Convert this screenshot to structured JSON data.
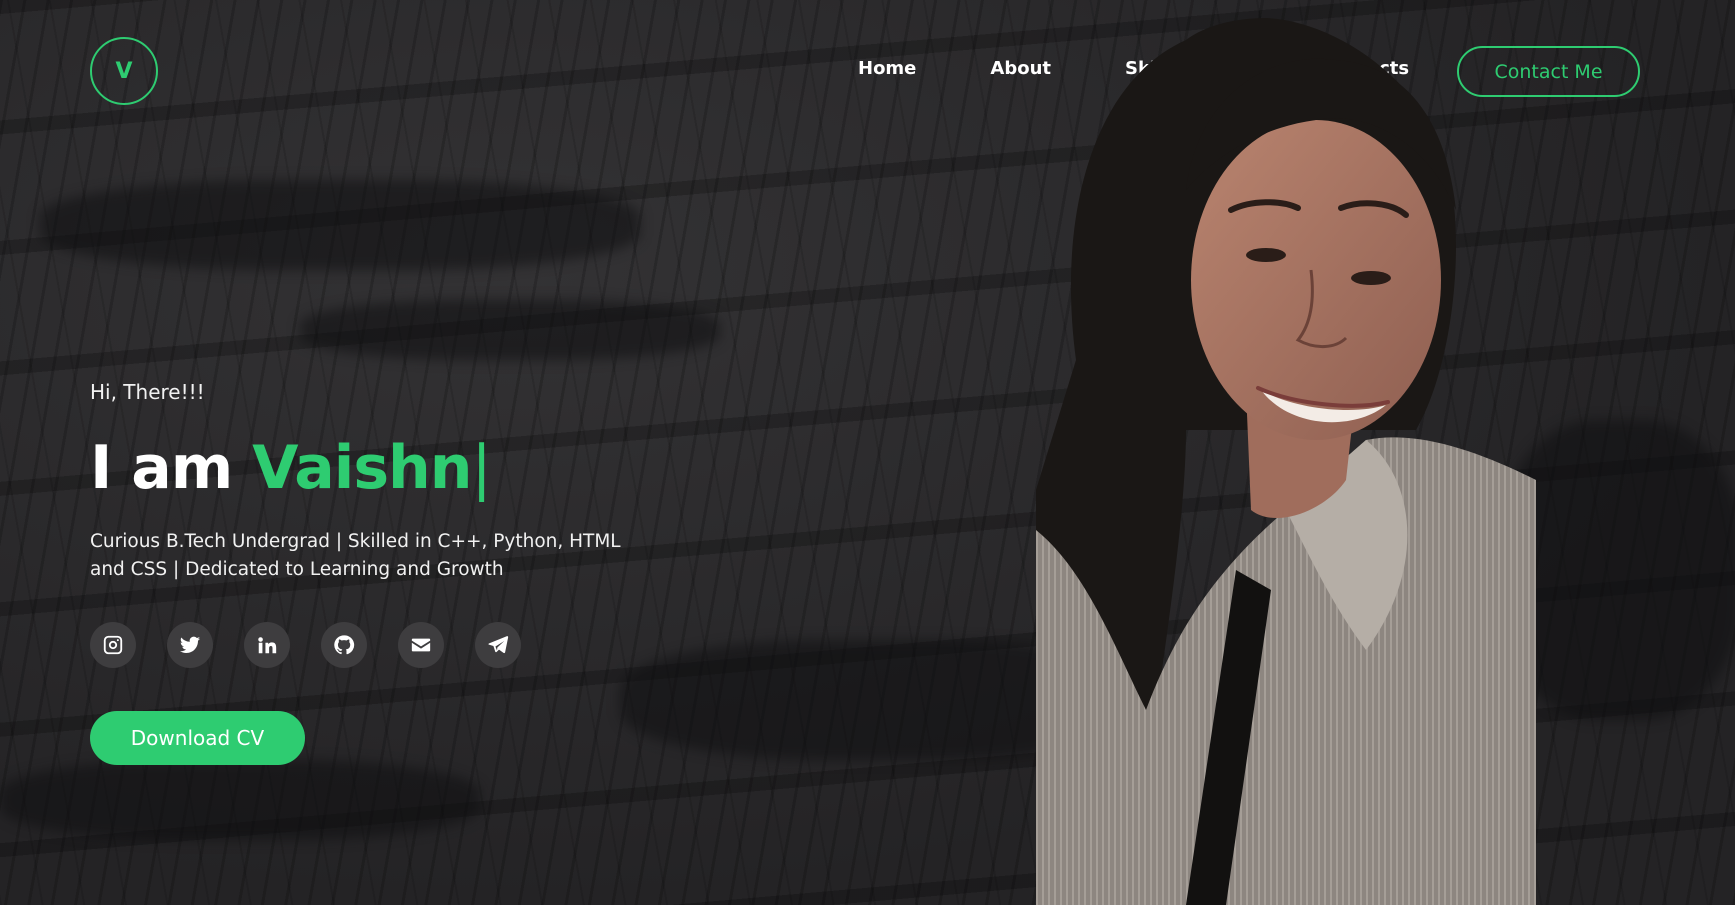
{
  "nav": {
    "logo_letter": "V",
    "items": [
      {
        "label": "Home"
      },
      {
        "label": "About"
      },
      {
        "label": "Skills & Edu."
      },
      {
        "label": "Projects"
      }
    ],
    "contact_label": "Contact Me"
  },
  "hero": {
    "greeting": "Hi, There!!!",
    "intro": "I am",
    "name_typed": "Vaishn",
    "cursor": "|",
    "tagline": "Curious B.Tech Undergrad | Skilled in C++, Python, HTML and CSS | Dedicated to Learning and Growth",
    "download_label": "Download CV"
  },
  "socials": [
    {
      "icon": "instagram-icon"
    },
    {
      "icon": "twitter-icon"
    },
    {
      "icon": "linkedin-icon"
    },
    {
      "icon": "github-icon"
    },
    {
      "icon": "mail-icon"
    },
    {
      "icon": "telegram-icon"
    }
  ],
  "colors": {
    "accent": "#2ecc71",
    "background": "#2a292b",
    "social_bg": "#3e3d3f"
  }
}
